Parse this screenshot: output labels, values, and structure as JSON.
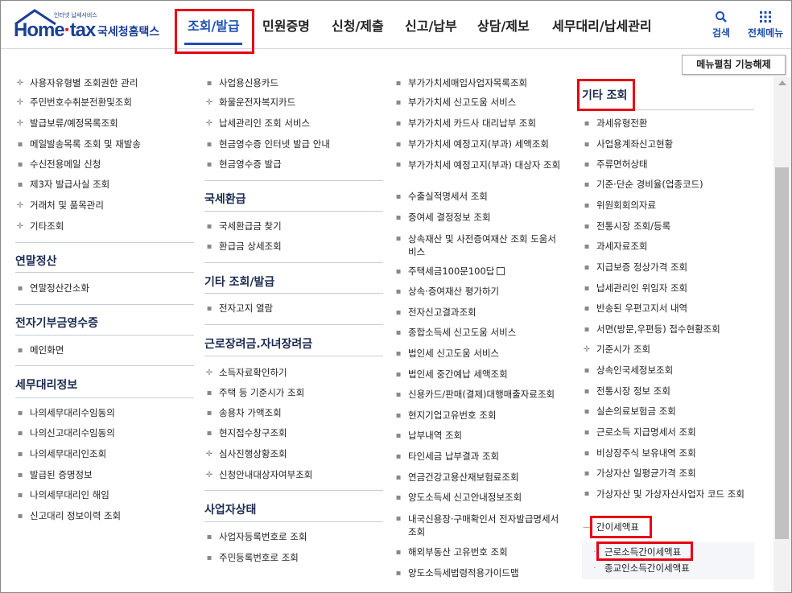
{
  "brand": {
    "tagline": "인터넷 납세서비스",
    "logo_home": "Home",
    "logo_tax": "tax",
    "logo_sub": "국세청홈택스",
    "accent": "#1f4fb0",
    "highlight": "#e60012"
  },
  "gnb": {
    "items": [
      "조회/발급",
      "민원증명",
      "신청/제출",
      "신고/납부",
      "상담/제보",
      "세무대리/납세관리"
    ],
    "active_index": 0
  },
  "tools": {
    "search": "검색",
    "all_menu": "전체메뉴"
  },
  "toolbar": {
    "menu_toggle": "메뉴펼침 기능해제"
  },
  "col1": {
    "items": [
      "사용자유형별 조회권한 관리",
      "주민번호수취분전환및조회",
      "발급보류/예정목록조회",
      "메일발송목록 조회 및 재발송",
      "수신전용메일 신청",
      "제3자 발급사실 조회",
      "거래처 및 품목관리",
      "기타조회"
    ],
    "sec1": "연말정산",
    "sec1_items": [
      "연말정산간소화"
    ],
    "sec2": "전자기부금영수증",
    "sec2_items": [
      "메인화면"
    ],
    "sec3": "세무대리정보",
    "sec3_items": [
      "나의세무대리수임동의",
      "나의신고대리수임동의",
      "나의세무대리인조회",
      "발급된 증명정보",
      "나의세무대리인 해임",
      "신고대리 정보이력 조회"
    ]
  },
  "col2": {
    "items": [
      "사업용신용카드",
      "화물운전자복지카드",
      "납세관리인 조회 서비스",
      "현금영수증 인터넷 발급 안내",
      "현금영수증 발급"
    ],
    "sec1": "국세환급",
    "sec1_items": [
      "국세환급금 찾기",
      "환급금 상세조회"
    ],
    "sec2": "기타 조회/발급",
    "sec2_items": [
      "전자고지 열람"
    ],
    "sec3": "근로장려금.자녀장려금",
    "sec3_items": [
      "소득자료확인하기",
      "주택 등 기준시가 조회",
      "송용차 가액조회",
      "현지접수창구조회",
      "심사진행상황조회",
      "신청안내대상자여부조회"
    ],
    "sec4": "사업자상태",
    "sec4_items": [
      "사업자등록번호로 조회",
      "주민등록번호로 조회"
    ]
  },
  "col3": {
    "items": [
      "부가가치세매입사업자목록조회",
      "부가가치세 신고도움 서비스",
      "부가가치세 카드사 대리납부 조회",
      "부가가치세 예정고지(부과) 세액조회",
      "부가가치세 예정고지(부과) 대상자 조회",
      "수출실적명세서 조회",
      "증여세 결정정보 조회",
      "상속재산 및 사전증여재산 조회 도움서비스",
      "주택세금100문100답",
      "상속·증여재산 평가하기",
      "전자신고결과조회",
      "종합소득세 신고도움 서비스",
      "법인세 신고도움 서비스",
      "법인세 중간예납 세액조회",
      "신용카드/판매(결제)대행매출자료조회",
      "현지기업고유번호 조회",
      "납부내역 조회",
      "타인세금 납부결과 조회",
      "연금건강고용산재보험료조회",
      "양도소득세 신고안내정보조회",
      "내국신용장·구매확인서 전자발급명세서 조회",
      "해외부동산 고유번호 조회",
      "양도소득세법령적용가이드맵"
    ]
  },
  "col4": {
    "title": "기타 조회",
    "items": [
      "과세유형전환",
      "사업용계좌신고현황",
      "주류면허상태",
      "기준·단순 경비율(업종코드)",
      "위원회회의자료",
      "전통시장 조회/등록",
      "과세자료조회",
      "지급보증 정상가격 조회",
      "납세관리인 위임자 조회",
      "반송된 우편고지서 내역",
      "서면(방문,우편등) 접수현황조회",
      "기준시가 조회",
      "상속인국세정보조회",
      "전통시장 정보 조회",
      "실손의료보험금 조회",
      "근로소득 지급명세서 조회",
      "비상장주식 보유내역 조회",
      "가상자산 일평균가격 조회",
      "가상자산 및 가상자산사업자 코드 조회"
    ],
    "group": "간이세액표",
    "group_items": [
      "근로소득간이세액표",
      "종교인소득간이세액표"
    ]
  }
}
